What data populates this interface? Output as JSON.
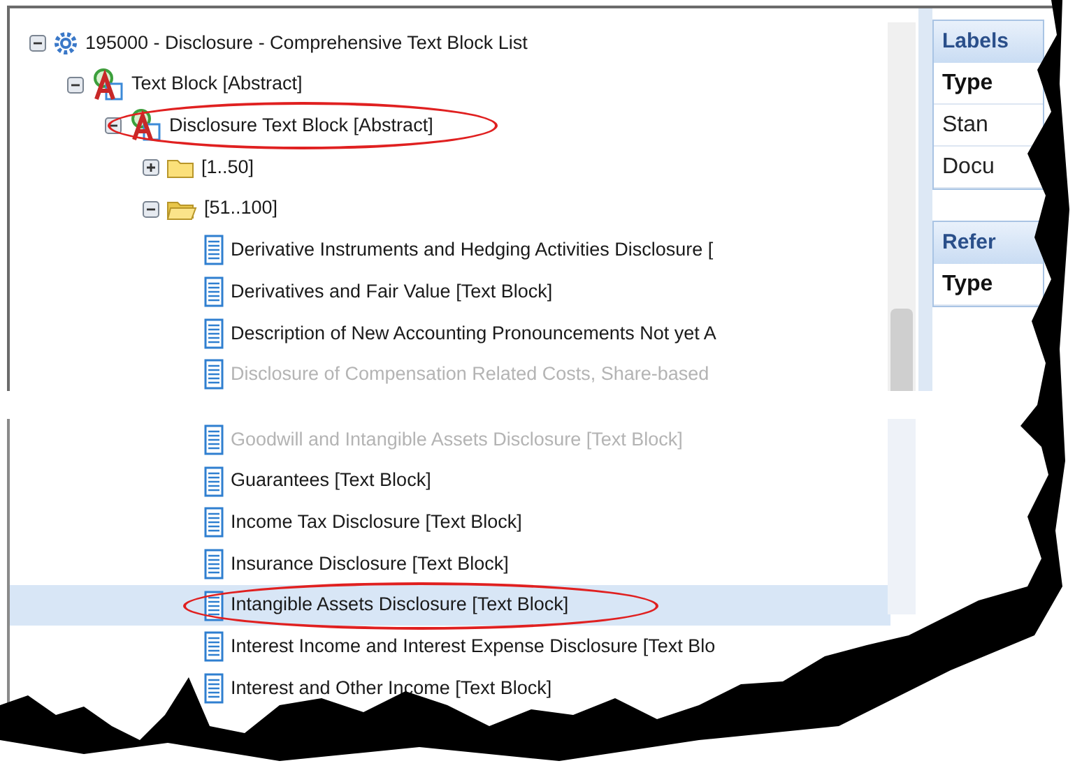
{
  "tree": [
    {
      "label": "195000 - Disclosure - Comprehensive Text Block List",
      "kind": "network",
      "expanded": true,
      "selected": false,
      "circled": false,
      "children": [
        {
          "label": "Text Block [Abstract]",
          "kind": "abstract",
          "expanded": true,
          "selected": false,
          "circled": false,
          "children": [
            {
              "label": "Disclosure Text Block [Abstract]",
              "kind": "abstract",
              "expanded": true,
              "selected": false,
              "circled": true,
              "children": [
                {
                  "label": "[1..50]",
                  "kind": "folder",
                  "expanded": false,
                  "selected": false,
                  "circled": false
                },
                {
                  "label": "[51..100]",
                  "kind": "folder",
                  "expanded": true,
                  "selected": false,
                  "circled": false,
                  "children": [
                    {
                      "label": "Derivative Instruments and Hedging Activities Disclosure [",
                      "kind": "element",
                      "selected": false,
                      "circled": false,
                      "dimmed": false,
                      "cut_before": false
                    },
                    {
                      "label": "Derivatives and Fair Value [Text Block]",
                      "kind": "element",
                      "selected": false,
                      "circled": false,
                      "dimmed": false,
                      "cut_before": false
                    },
                    {
                      "label": "Description of New Accounting Pronouncements Not yet A",
                      "kind": "element",
                      "selected": false,
                      "circled": false,
                      "dimmed": false,
                      "cut_before": false
                    },
                    {
                      "label": "Disclosure of Compensation Related Costs, Share-based",
                      "kind": "element",
                      "selected": false,
                      "circled": false,
                      "dimmed": true,
                      "cut_before": false
                    },
                    {
                      "label": "Goodwill and Intangible Assets Disclosure [Text Block]",
                      "kind": "element",
                      "selected": false,
                      "circled": false,
                      "dimmed": true,
                      "cut_before": true
                    },
                    {
                      "label": "Guarantees [Text Block]",
                      "kind": "element",
                      "selected": false,
                      "circled": false,
                      "dimmed": false,
                      "cut_before": false
                    },
                    {
                      "label": "Income Tax Disclosure [Text Block]",
                      "kind": "element",
                      "selected": false,
                      "circled": false,
                      "dimmed": false,
                      "cut_before": false
                    },
                    {
                      "label": "Insurance Disclosure [Text Block]",
                      "kind": "element",
                      "selected": false,
                      "circled": false,
                      "dimmed": false,
                      "cut_before": false
                    },
                    {
                      "label": "Intangible Assets Disclosure [Text Block]",
                      "kind": "element",
                      "selected": true,
                      "circled": true,
                      "dimmed": false,
                      "cut_before": false
                    },
                    {
                      "label": "Interest Income and Interest Expense Disclosure [Text Blo",
                      "kind": "element",
                      "selected": false,
                      "circled": false,
                      "dimmed": false,
                      "cut_before": false
                    },
                    {
                      "label": "Interest and Other Income [Text Block]",
                      "kind": "element",
                      "selected": false,
                      "circled": false,
                      "dimmed": false,
                      "cut_before": false
                    }
                  ]
                }
              ]
            }
          ]
        }
      ]
    }
  ],
  "panels": [
    {
      "title": "Labels",
      "rows": [
        {
          "text": "Type",
          "kind": "header"
        },
        {
          "text": "Stan",
          "kind": "cell"
        },
        {
          "text": "Docu",
          "kind": "cell"
        }
      ]
    },
    {
      "title": "Refer",
      "rows": [
        {
          "text": "Type",
          "kind": "header"
        }
      ]
    }
  ]
}
